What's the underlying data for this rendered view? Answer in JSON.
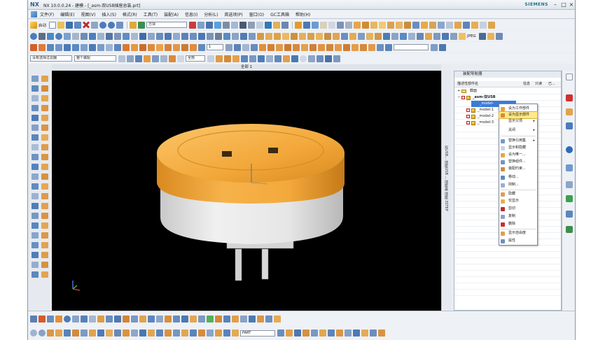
{
  "window": {
    "logo": "NX",
    "title": "NX 10.0.0.24 - 建模 - [_asm-双USB插座总装.prt]",
    "brand": "SIEMENS",
    "controls": [
      "–",
      "□",
      "×"
    ]
  },
  "menubar": {
    "items": [
      "文件(F)",
      "编辑(E)",
      "视图(V)",
      "插入(S)",
      "格式(R)",
      "工具(T)",
      "装配(A)",
      "信息(I)",
      "分析(L)",
      "首选项(P)",
      "窗口(O)",
      "GC工具箱",
      "帮助(H)"
    ]
  },
  "toolbar": {
    "start_label": "启动",
    "search_value": "方块",
    "scale_value": "1",
    "jpeg_label": "JPEG",
    "filter_value": "没有选择过滤器",
    "assembly_value": "整个装配",
    "whole_label": "全部"
  },
  "viewport": {
    "label": "全部 1",
    "background": "#000000",
    "model_colors": {
      "top": "#f0a338",
      "body": "#e2e2e2",
      "pins": "#d8d8d8"
    }
  },
  "side_vertical_text": "双USB... 插座USB ... 插座盖 插座 3STEP",
  "navigator": {
    "title": "装配导航器",
    "columns": {
      "name": "描述性部件名",
      "info": "信息",
      "readonly": "只读",
      "modified": "已..."
    },
    "rows": [
      {
        "label": "截面",
        "level": 1
      },
      {
        "label": "_asm-双USB",
        "level": 1
      },
      {
        "label": "_model-",
        "level": 2,
        "selected": true
      },
      {
        "label": "_model-1",
        "level": 2
      },
      {
        "label": "_model-2",
        "level": 2
      },
      {
        "label": "_model-3",
        "level": 2
      }
    ]
  },
  "context_menu": {
    "items": [
      {
        "label": "设为工作部件",
        "highlight": false
      },
      {
        "label": "设为显示部件",
        "highlight": true
      },
      {
        "label": "显示父项",
        "submenu": true
      },
      {
        "label": "关闭",
        "submenu": true
      },
      {
        "label": "替换引用集",
        "submenu": true
      },
      {
        "label": "显示和隐藏"
      },
      {
        "label": "设为唯一..."
      },
      {
        "label": "替换组件..."
      },
      {
        "label": "装配约束..."
      },
      {
        "label": "移动..."
      },
      {
        "label": "抑制..."
      },
      {
        "label": "隐藏"
      },
      {
        "label": "仅显示"
      },
      {
        "label": "剪切"
      },
      {
        "label": "复制"
      },
      {
        "label": "删除"
      },
      {
        "label": "显示自由度"
      },
      {
        "label": "属性"
      }
    ]
  },
  "bottom_toolbar": {
    "part_value": "PART"
  }
}
